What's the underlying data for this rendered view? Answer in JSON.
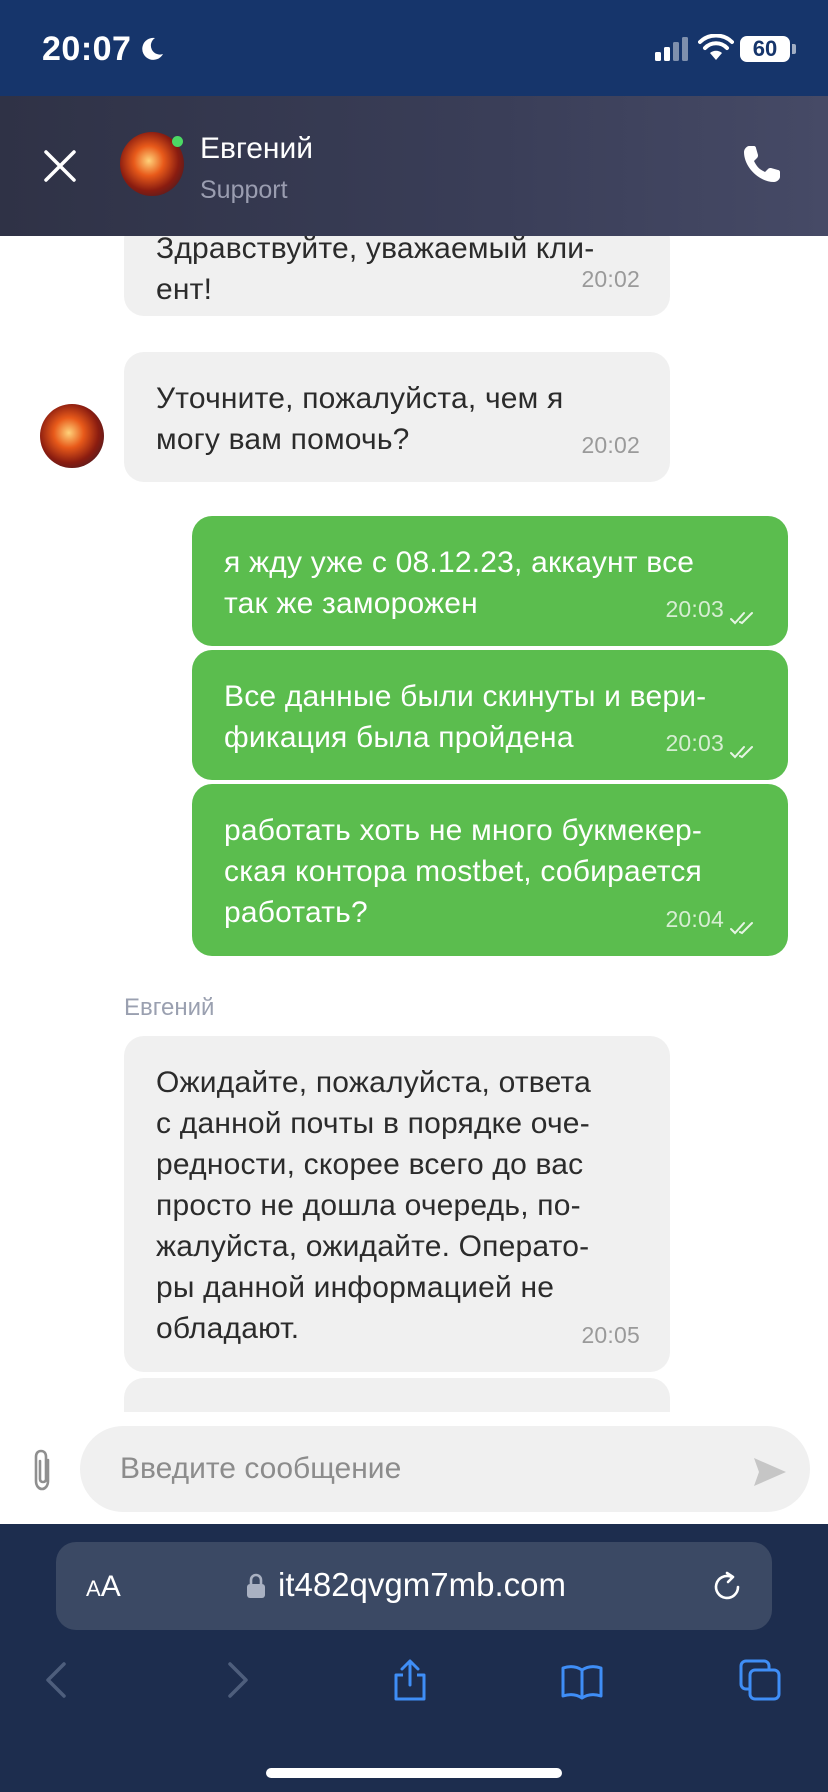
{
  "status_bar": {
    "time": "20:07",
    "battery": "60"
  },
  "header": {
    "contact_name": "Евгений",
    "contact_role": "Support"
  },
  "messages": [
    {
      "direction": "incoming",
      "text": "Здравствуйте, уважаемый кли-\nент!",
      "time": "20:02"
    },
    {
      "direction": "incoming",
      "text": "Уточните, пожалуйста, чем я\nмогу вам помочь?",
      "time": "20:02"
    },
    {
      "direction": "outgoing",
      "text": "я жду уже с 08.12.23, аккаунт все\nтак же заморожен",
      "time": "20:03"
    },
    {
      "direction": "outgoing",
      "text": "Все данные были скинуты и вери-\nфикация была пройдена",
      "time": "20:03"
    },
    {
      "direction": "outgoing",
      "text": "работать хоть не много букмекер-\nская контора mostbet, собирается\nработать?",
      "time": "20:04"
    },
    {
      "direction": "incoming",
      "sender": "Евгений",
      "text": "Ожидайте, пожалуйста, ответа\nс данной почты в порядке оче-\nредности, скорее всего до вас\nпросто не дошла очередь, по-\nжалуйста, ожидайте. Операто-\nры данной информацией не\nобладают.",
      "time": "20:05"
    }
  ],
  "composer": {
    "placeholder": "Введите сообщение"
  },
  "browser": {
    "aa_label_small": "A",
    "aa_label_large": "A",
    "url": "it482qvgm7mb.com"
  },
  "colors": {
    "header_bg": "#3a3e58",
    "outgoing_bubble": "#5bbd4e",
    "incoming_bubble": "#f0f0f0",
    "browser_bg": "#1d2d4e",
    "status_bar_bg": "#16356b"
  },
  "icons": [
    "moon-icon",
    "signal-icon",
    "wifi-icon",
    "close-icon",
    "phone-icon",
    "double-check-icon",
    "chevron-down-icon",
    "paperclip-icon",
    "send-icon",
    "lock-icon",
    "reload-icon",
    "back-icon",
    "forward-icon",
    "share-icon",
    "bookmarks-icon",
    "tabs-icon"
  ]
}
